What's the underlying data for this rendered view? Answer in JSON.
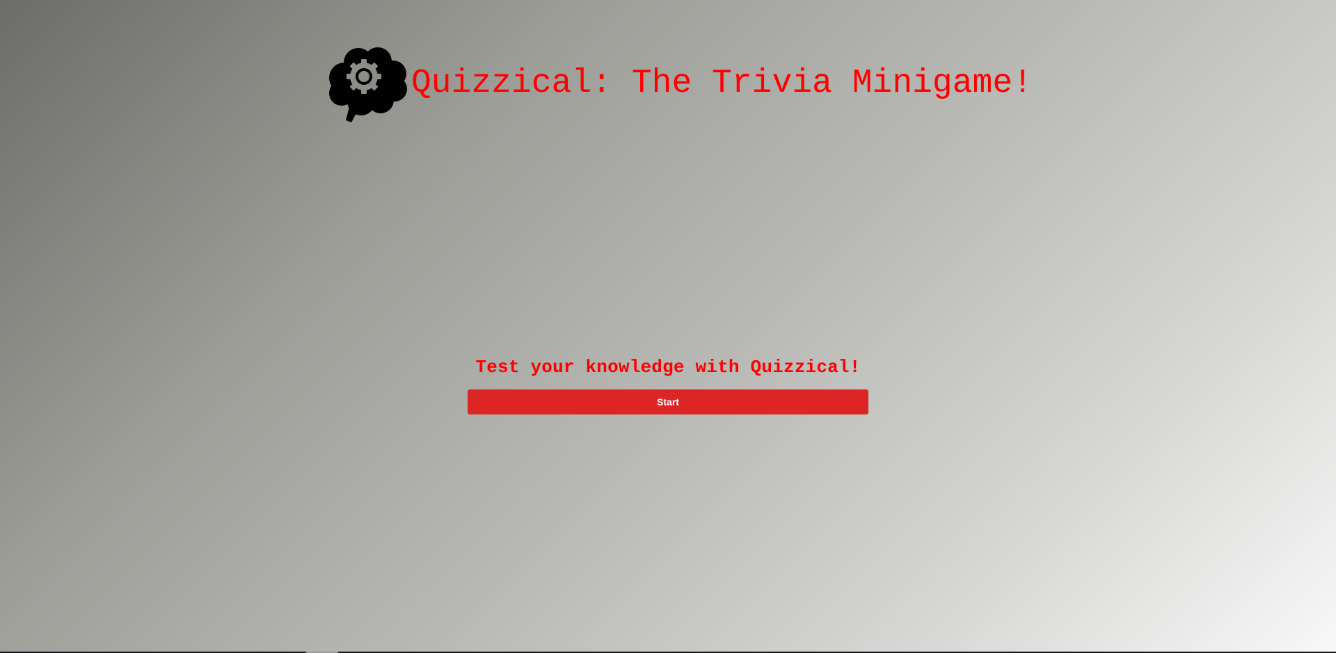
{
  "header": {
    "logo_icon": "brain-gear-icon",
    "title": "Quizzical: The Trivia Minigame!"
  },
  "main": {
    "tagline": "Test your knowledge with Quizzical!",
    "start_label": "Start"
  },
  "colors": {
    "title_text": "#ff0000",
    "button_bg": "#dc2626",
    "button_text": "#ffffff",
    "logo": "#000000"
  }
}
